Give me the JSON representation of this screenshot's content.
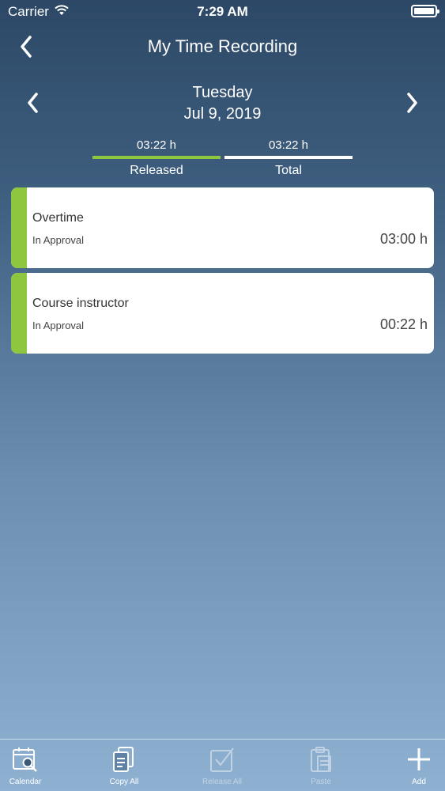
{
  "status_bar": {
    "carrier": "Carrier",
    "time": "7:29 AM"
  },
  "nav": {
    "title": "My Time Recording"
  },
  "date": {
    "weekday": "Tuesday",
    "date": "Jul 9, 2019"
  },
  "summary": {
    "released": {
      "value": "03:22 h",
      "label": "Released"
    },
    "total": {
      "value": "03:22 h",
      "label": "Total"
    }
  },
  "entries": [
    {
      "title": "Overtime",
      "status": "In Approval",
      "duration": "03:00 h"
    },
    {
      "title": "Course instructor",
      "status": "In Approval",
      "duration": "00:22 h"
    }
  ],
  "colors": {
    "accent_green": "#8fc63f",
    "card_bg": "#ffffff"
  },
  "tabs": [
    {
      "label": "Calendar",
      "icon": "calendar-search-icon",
      "enabled": true
    },
    {
      "label": "Copy All",
      "icon": "copy-icon",
      "enabled": true
    },
    {
      "label": "Release All",
      "icon": "checkbox-check-icon",
      "enabled": false
    },
    {
      "label": "Paste",
      "icon": "clipboard-icon",
      "enabled": false
    },
    {
      "label": "Add",
      "icon": "plus-icon",
      "enabled": true
    }
  ]
}
